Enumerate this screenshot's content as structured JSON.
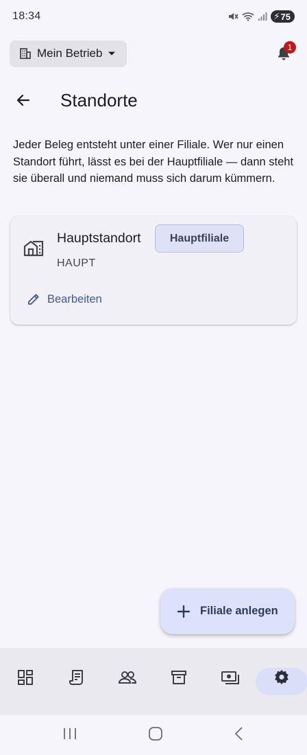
{
  "status_bar": {
    "time": "18:34",
    "battery": "75"
  },
  "top_bar": {
    "company": "Mein Betrieb",
    "notification_count": "1"
  },
  "header": {
    "title": "Standorte"
  },
  "intro_text": "Jeder Beleg entsteht unter einer Filiale. Wer nur einen Standort führt, lässt es bei der Hauptfiliale — dann steht sie überall und niemand muss sich darum kümmern.",
  "locations": [
    {
      "name": "Hauptstandort",
      "badge": "Hauptfiliale",
      "code": "HAUPT",
      "edit_label": "Bearbeiten"
    }
  ],
  "fab": {
    "label": "Filiale anlegen"
  },
  "bottom_nav": {
    "items": [
      {
        "icon": "dashboard-icon"
      },
      {
        "icon": "receipt-icon"
      },
      {
        "icon": "people-icon"
      },
      {
        "icon": "archive-icon"
      },
      {
        "icon": "cash-icon"
      },
      {
        "icon": "settings-icon",
        "active": true
      }
    ]
  },
  "colors": {
    "accent": "#3f5a8a",
    "active_pill": "#d9dff8",
    "badge_red": "#ba1a1a"
  }
}
